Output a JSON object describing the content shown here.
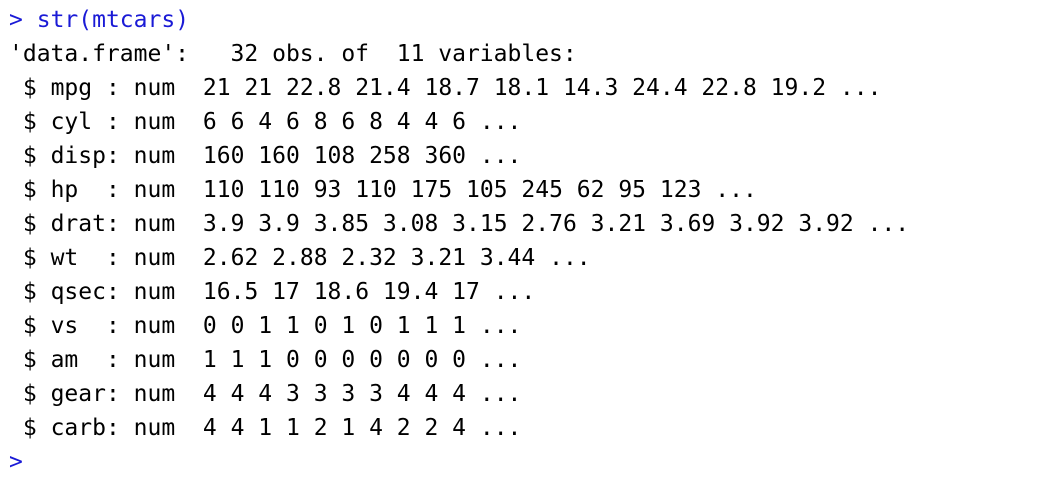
{
  "console": {
    "prompt": ">",
    "command": "str(mtcars)",
    "header": "'data.frame':\t32 obs. of  11 variables:",
    "rows": [
      {
        "dollar": "$",
        "name": "mpg ",
        "type": "num",
        "values": "21 21 22.8 21.4 18.7 18.1 14.3 24.4 22.8 19.2 ..."
      },
      {
        "dollar": "$",
        "name": "cyl ",
        "type": "num",
        "values": "6 6 4 6 8 6 8 4 4 6 ..."
      },
      {
        "dollar": "$",
        "name": "disp",
        "type": "num",
        "values": "160 160 108 258 360 ..."
      },
      {
        "dollar": "$",
        "name": "hp  ",
        "type": "num",
        "values": "110 110 93 110 175 105 245 62 95 123 ..."
      },
      {
        "dollar": "$",
        "name": "drat",
        "type": "num",
        "values": "3.9 3.9 3.85 3.08 3.15 2.76 3.21 3.69 3.92 3.92 ..."
      },
      {
        "dollar": "$",
        "name": "wt  ",
        "type": "num",
        "values": "2.62 2.88 2.32 3.21 3.44 ..."
      },
      {
        "dollar": "$",
        "name": "qsec",
        "type": "num",
        "values": "16.5 17 18.6 19.4 17 ..."
      },
      {
        "dollar": "$",
        "name": "vs  ",
        "type": "num",
        "values": "0 0 1 1 0 1 0 1 1 1 ..."
      },
      {
        "dollar": "$",
        "name": "am  ",
        "type": "num",
        "values": "1 1 1 0 0 0 0 0 0 0 ..."
      },
      {
        "dollar": "$",
        "name": "gear",
        "type": "num",
        "values": "4 4 4 3 3 3 3 4 4 4 ..."
      },
      {
        "dollar": "$",
        "name": "carb",
        "type": "num",
        "values": "4 4 1 1 2 1 4 2 2 4 ..."
      }
    ],
    "empty_prompt": ">"
  },
  "colors": {
    "input": "#1a1ad6",
    "output": "#000000",
    "background": "#ffffff"
  }
}
